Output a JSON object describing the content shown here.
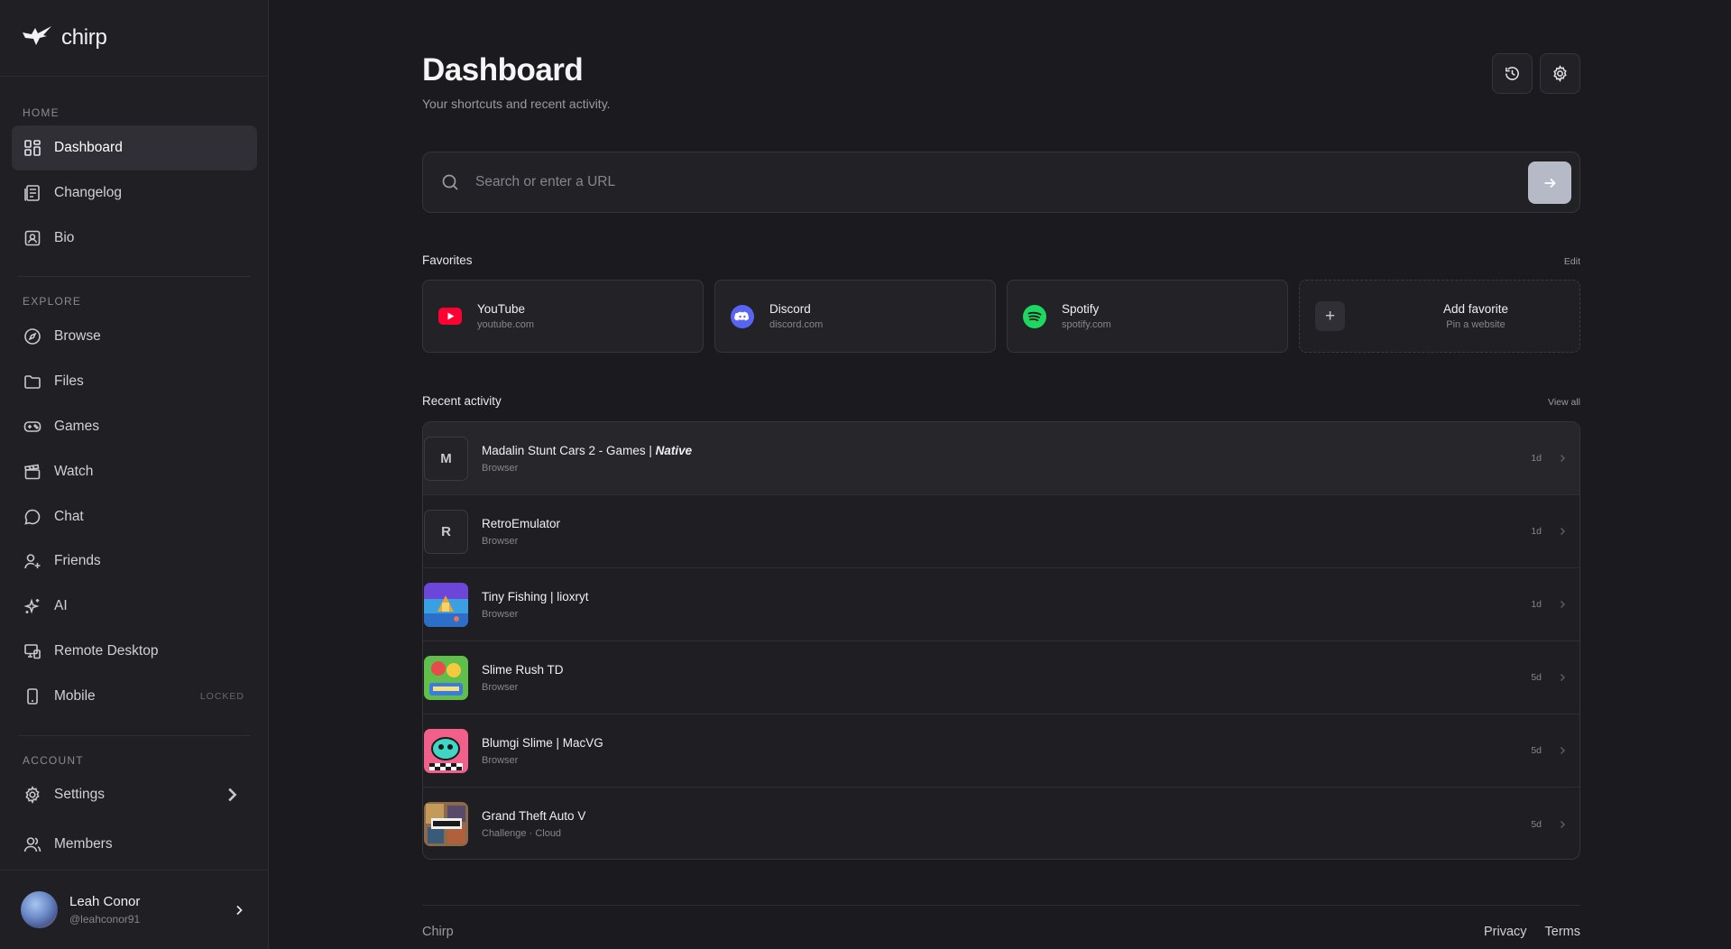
{
  "brand": {
    "name": "chirp"
  },
  "sidebar": {
    "home_label": "HOME",
    "explore_label": "EXPLORE",
    "account_label": "ACCOUNT",
    "home_items": [
      {
        "label": "Dashboard",
        "icon": "dashboard-icon"
      },
      {
        "label": "Changelog",
        "icon": "changelog-icon"
      },
      {
        "label": "Bio",
        "icon": "bio-icon"
      }
    ],
    "explore_items": [
      {
        "label": "Browse",
        "icon": "compass-icon"
      },
      {
        "label": "Files",
        "icon": "folder-icon"
      },
      {
        "label": "Games",
        "icon": "gamepad-icon"
      },
      {
        "label": "Watch",
        "icon": "clapper-icon"
      },
      {
        "label": "Chat",
        "icon": "chat-icon"
      },
      {
        "label": "Friends",
        "icon": "user-plus-icon"
      },
      {
        "label": "AI",
        "icon": "sparkles-icon"
      },
      {
        "label": "Remote Desktop",
        "icon": "remote-desktop-icon"
      },
      {
        "label": "Mobile",
        "icon": "mobile-icon",
        "badge": "LOCKED"
      }
    ],
    "account_items": [
      {
        "label": "Settings",
        "icon": "gear-icon"
      },
      {
        "label": "Members",
        "icon": "users-icon"
      }
    ],
    "user": {
      "name": "Leah Conor",
      "handle": "@leahconor91"
    }
  },
  "header": {
    "title": "Dashboard",
    "subtitle": "Your shortcuts and recent activity."
  },
  "search": {
    "placeholder": "Search or enter a URL"
  },
  "favorites": {
    "title": "Favorites",
    "edit_label": "Edit",
    "items": [
      {
        "name": "YouTube",
        "url": "youtube.com",
        "color": "#ff0033"
      },
      {
        "name": "Discord",
        "url": "discord.com",
        "color": "#5865f2"
      },
      {
        "name": "Spotify",
        "url": "spotify.com",
        "color": "#1ed760"
      }
    ],
    "add": {
      "name": "Add favorite",
      "sub": "Pin a website"
    }
  },
  "activity": {
    "title": "Recent activity",
    "view_all_label": "View all",
    "items": [
      {
        "title": "Madalin Stunt Cars 2 - Games | ",
        "title_em": "Native",
        "sub": "Browser",
        "time": "1d",
        "letter": "M"
      },
      {
        "title": "RetroEmulator",
        "title_em": "",
        "sub": "Browser",
        "time": "1d",
        "letter": "R"
      },
      {
        "title": "Tiny Fishing | lioxryt",
        "title_em": "",
        "sub": "Browser",
        "time": "1d",
        "letter": ""
      },
      {
        "title": "Slime Rush TD",
        "title_em": "",
        "sub": "Browser",
        "time": "5d",
        "letter": ""
      },
      {
        "title": "Blumgi Slime | MacVG",
        "title_em": "",
        "sub": "Browser",
        "time": "5d",
        "letter": ""
      },
      {
        "title": "Grand Theft Auto V",
        "title_em": "",
        "sub": "Challenge · Cloud",
        "time": "5d",
        "letter": ""
      }
    ]
  },
  "footer": {
    "brand": "Chirp",
    "privacy": "Privacy",
    "terms": "Terms"
  }
}
